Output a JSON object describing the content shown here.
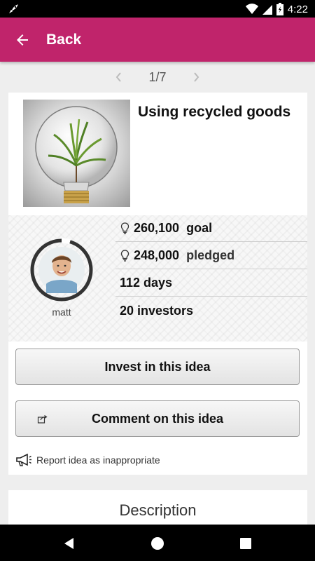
{
  "status_bar": {
    "time": "4:22",
    "icons": [
      "rocket-icon",
      "wifi-icon",
      "signal-icon",
      "battery-icon"
    ]
  },
  "app_bar": {
    "back_label": "Back",
    "color": "#c0246b"
  },
  "pager": {
    "label": "1/7"
  },
  "idea": {
    "title": "Using recycled goods",
    "image": "lightbulb-plant-photo",
    "owner": {
      "name": "matt",
      "avatar": "avatar-photo"
    },
    "stats": {
      "goal_value": "260,100",
      "goal_unit": "goal",
      "pledged_value": "248,000",
      "pledged_unit": "pledged",
      "days": "112 days",
      "investors": "20 investors"
    }
  },
  "actions": {
    "invest_label": "Invest in this idea",
    "comment_label": "Comment on this idea",
    "report_label": "Report idea as inappropriate"
  },
  "description": {
    "heading": "Description"
  }
}
